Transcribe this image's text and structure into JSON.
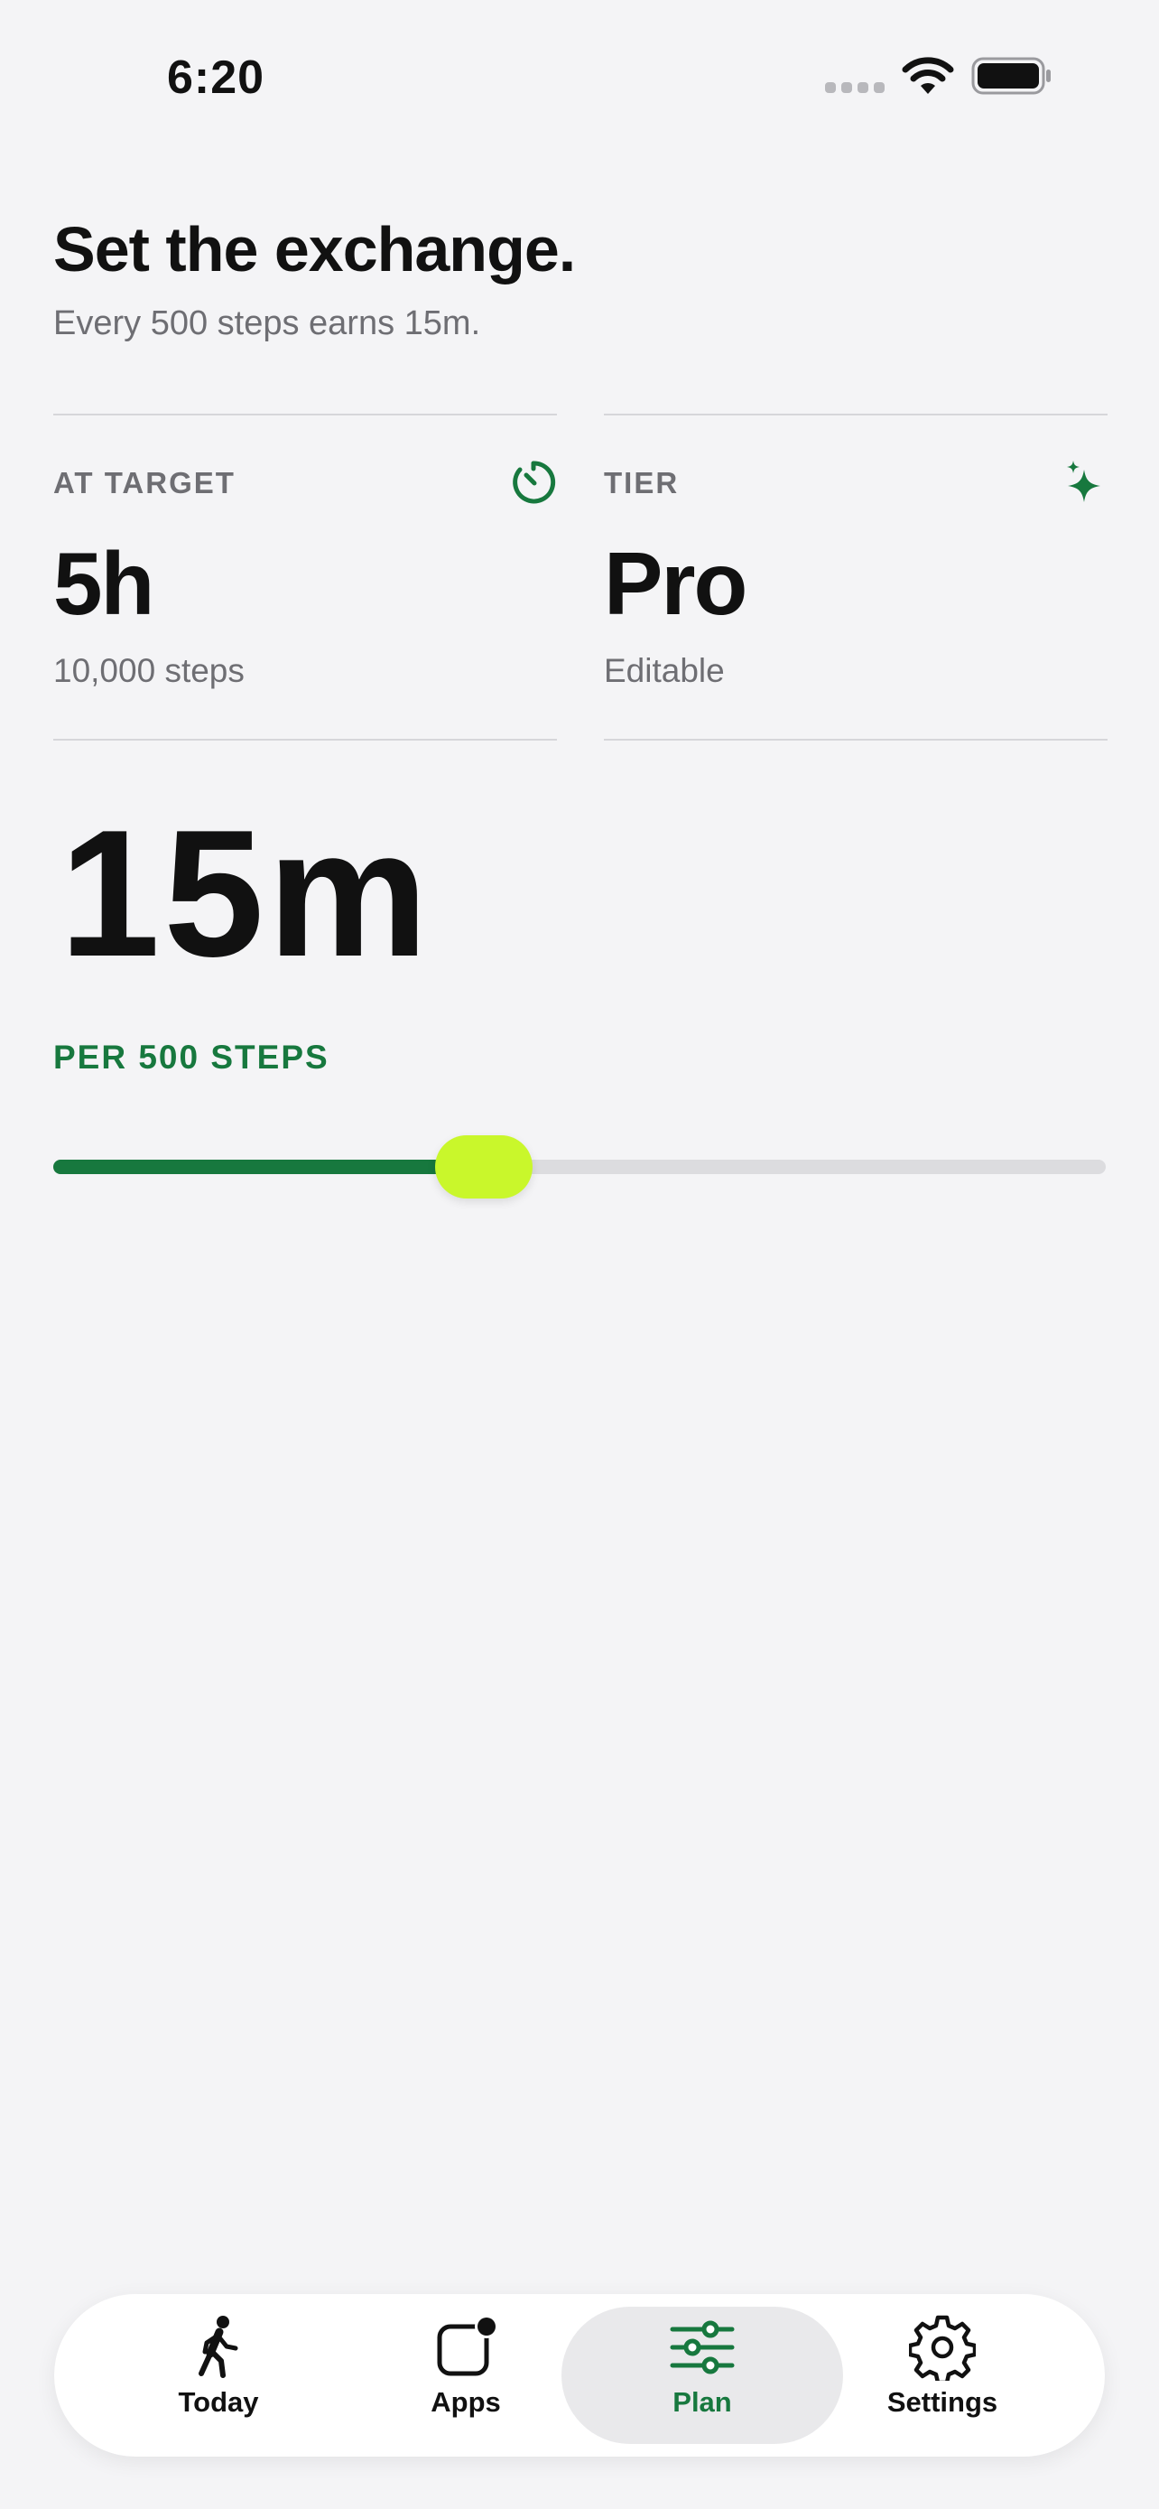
{
  "status_bar": {
    "time": "6:20",
    "icons": [
      "signal-dots-icon",
      "wifi-icon",
      "battery-icon"
    ]
  },
  "header": {
    "title": "Set the exchange.",
    "subtitle": "Every 500 steps earns 15m."
  },
  "cards": [
    {
      "label": "AT TARGET",
      "value": "5h",
      "caption": "10,000 steps",
      "icon": "timer-icon"
    },
    {
      "label": "TIER",
      "value": "Pro",
      "caption": "Editable",
      "icon": "sparkle-icon"
    }
  ],
  "rate": {
    "value": "15m",
    "unit_label": "PER 500 STEPS"
  },
  "slider": {
    "fraction": 0.409
  },
  "tabs": [
    {
      "label": "Today",
      "icon": "walking-icon",
      "active": false
    },
    {
      "label": "Apps",
      "icon": "apps-badge-icon",
      "active": false
    },
    {
      "label": "Plan",
      "icon": "sliders-icon",
      "active": true
    },
    {
      "label": "Settings",
      "icon": "gear-icon",
      "active": false
    }
  ],
  "colors": {
    "accent_green": "#17783e",
    "thumb_lime": "#c9f72b",
    "background": "#f4f4f6",
    "text_primary": "#111111",
    "text_secondary": "#6e6e73"
  }
}
